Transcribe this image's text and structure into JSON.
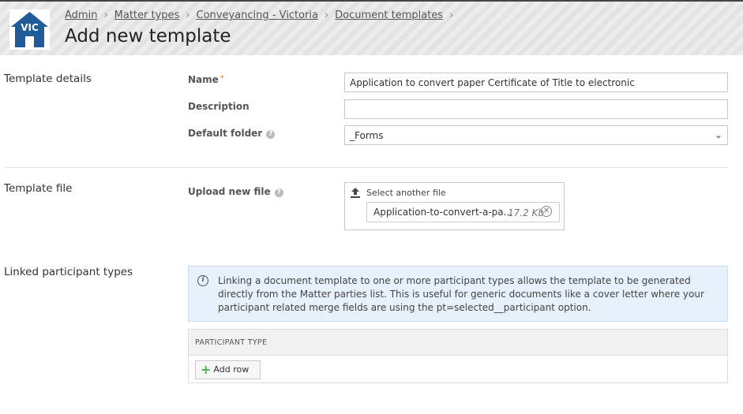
{
  "header": {
    "logo_text": "VIC",
    "breadcrumb": [
      "Admin",
      "Matter types",
      "Conveyancing - Victoria",
      "Document templates"
    ],
    "title": "Add new template"
  },
  "template_details": {
    "section_label": "Template details",
    "name_label": "Name",
    "name_required_marker": "*",
    "name_value": "Application to convert paper Certificate of Title to electronic",
    "description_label": "Description",
    "description_value": "",
    "default_folder_label": "Default folder",
    "default_folder_value": "_Forms"
  },
  "template_file": {
    "section_label": "Template file",
    "upload_label": "Upload new file",
    "select_label": "Select another file",
    "file_name": "Application-to-convert-a-pa...",
    "file_size": "17.2 Kb"
  },
  "linked_participants": {
    "section_label": "Linked participant types",
    "info_text": "Linking a document template to one or more participant types allows the template to be generated directly from the Matter parties list. This is useful for generic documents like a cover letter where your participant related merge fields are using the pt=selected__participant option.",
    "table_header": "PARTICIPANT TYPE",
    "add_row_label": "Add row"
  },
  "colors": {
    "logo_blue": "#1f5c99",
    "info_bg": "#e6f1fb",
    "required": "#e07b2a",
    "add_icon": "#4caf50"
  }
}
